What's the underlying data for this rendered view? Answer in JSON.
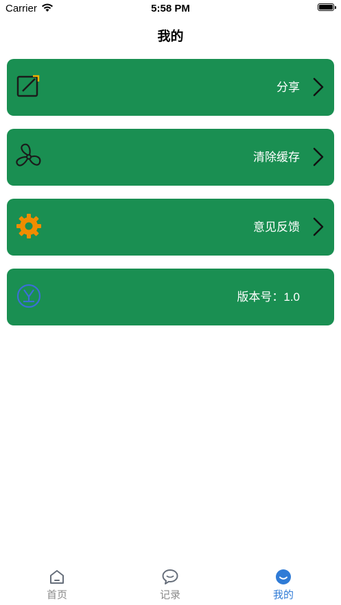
{
  "status_bar": {
    "carrier": "Carrier",
    "time": "5:58 PM"
  },
  "nav": {
    "title": "我的"
  },
  "menu": [
    {
      "label": "分享",
      "icon": "share-icon"
    },
    {
      "label": "清除缓存",
      "icon": "fan-icon"
    },
    {
      "label": "意见反馈",
      "icon": "gear-icon"
    },
    {
      "label": "版本号：1.0",
      "icon": "version-icon"
    }
  ],
  "tabs": [
    {
      "label": "首页",
      "icon": "home-icon"
    },
    {
      "label": "记录",
      "icon": "chat-bubble-icon"
    },
    {
      "label": "我的",
      "icon": "profile-smile-icon",
      "active": true
    }
  ],
  "colors": {
    "card": "#1a8f52",
    "tab_active": "#2f7bd6",
    "gear": "#f08c00"
  }
}
